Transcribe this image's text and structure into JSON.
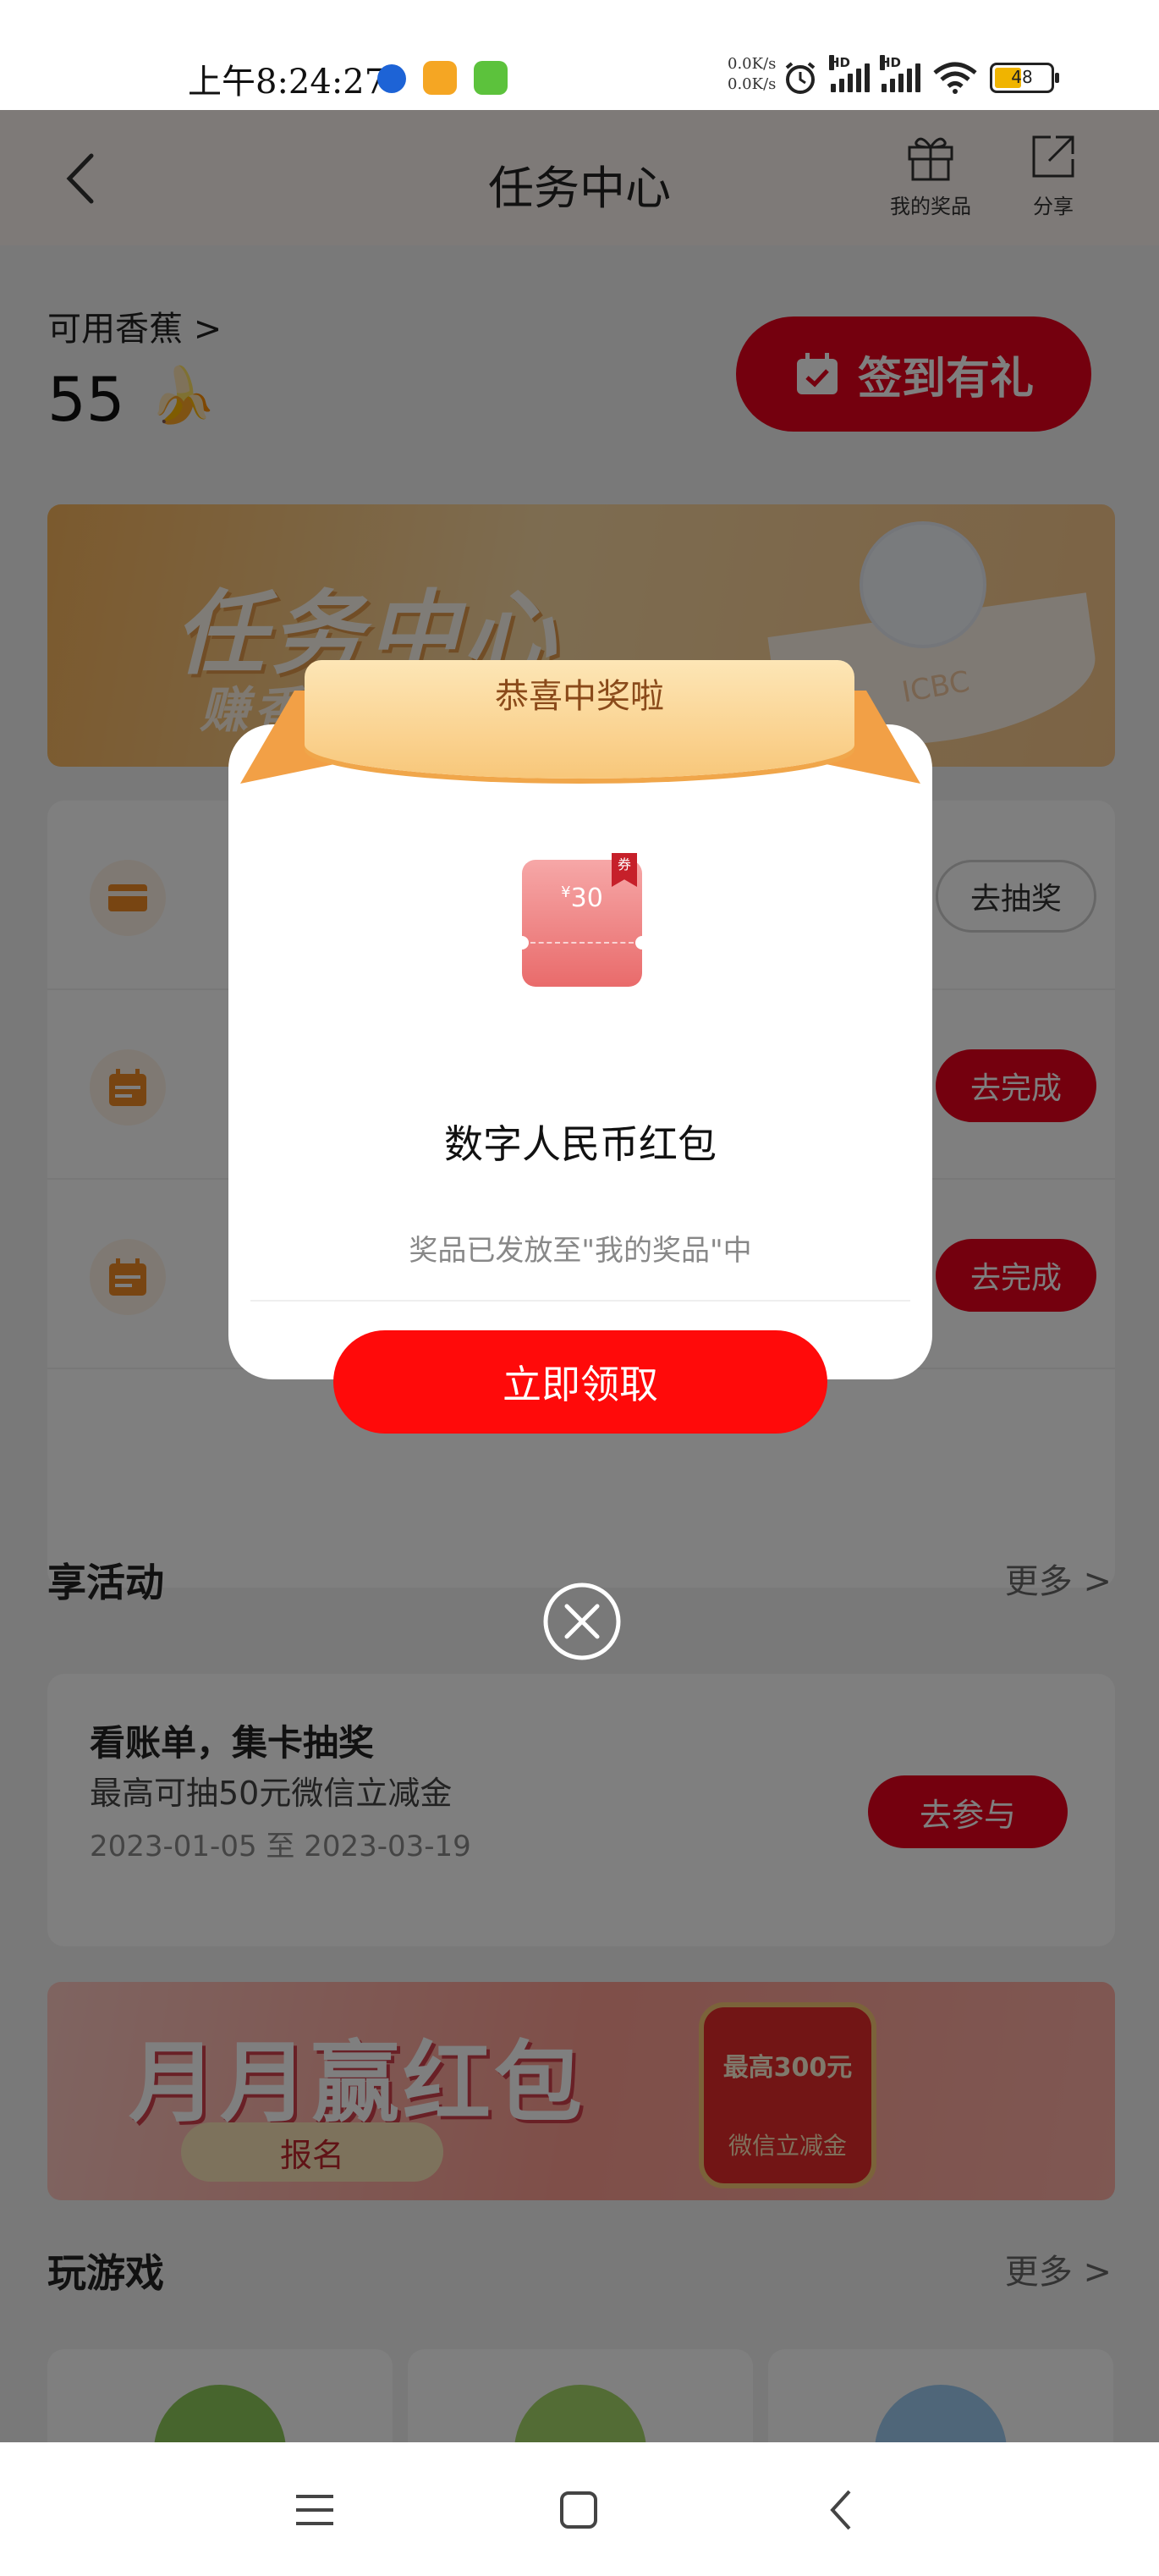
{
  "status_bar": {
    "time": "上午8:24:27",
    "net_up": "0.0K/s",
    "net_down": "0.0K/s",
    "hd1": "HD",
    "hd2": "HD",
    "battery": "48"
  },
  "header": {
    "title": "任务中心",
    "my_prizes": "我的奖品",
    "share": "分享"
  },
  "balance": {
    "label": "可用香蕉 >",
    "value": "55",
    "signin": "签到有礼"
  },
  "banner1": {
    "title": "任务中心",
    "subtitle": "赚香蕉 兑好礼",
    "brand": "ICBC"
  },
  "tasks": [
    {
      "button": "去抽奖",
      "style": "outline"
    },
    {
      "button": "去完成",
      "style": "fill"
    },
    {
      "button": "去完成",
      "style": "fill"
    }
  ],
  "activities_section": {
    "title": "享活动",
    "more": "更多 >",
    "card": {
      "title": "看账单，集卡抽奖",
      "subtitle": "最高可抽50元微信立减金",
      "dates": "2023-01-05 至 2023-03-19",
      "button": "去参与"
    }
  },
  "banner2": {
    "title": "月月赢红包",
    "register": "报名",
    "badge_top": "最高300元",
    "badge_bottom": "微信立减金"
  },
  "games_section": {
    "title": "玩游戏",
    "more": "更多 >"
  },
  "modal": {
    "ribbon": "恭喜中奖啦",
    "coupon_currency": "¥",
    "coupon_amount": "30",
    "coupon_tag": "券",
    "prize_name": "数字人民币红包",
    "note": "奖品已发放至\"我的奖品\"中",
    "claim": "立即领取"
  },
  "colors": {
    "primary_red": "#e8001c",
    "claim_red": "#ff0a0a",
    "ribbon_gold": "#f8c77a"
  }
}
